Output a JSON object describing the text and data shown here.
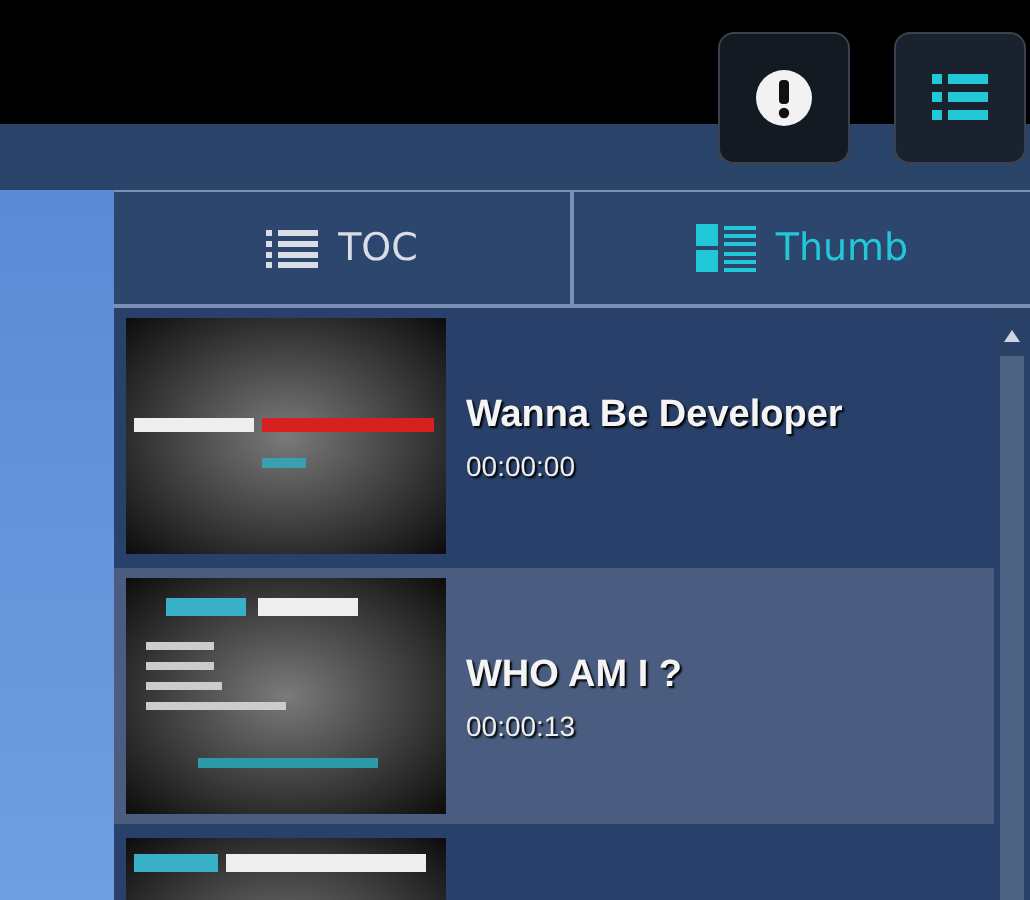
{
  "toolbar": {
    "buttons": [
      {
        "kind": "alert",
        "selected": false
      },
      {
        "kind": "list",
        "selected": true
      }
    ]
  },
  "tabs": [
    {
      "label": "TOC",
      "kind": "toc",
      "selected": false
    },
    {
      "label": "Thumb",
      "kind": "thumb",
      "selected": true
    }
  ],
  "slides": [
    {
      "title": "Wanna Be Developer",
      "time": "00:00:00",
      "selected": false
    },
    {
      "title": "WHO AM I ?",
      "time": "00:00:13",
      "selected": true
    },
    {
      "selected": false
    }
  ]
}
